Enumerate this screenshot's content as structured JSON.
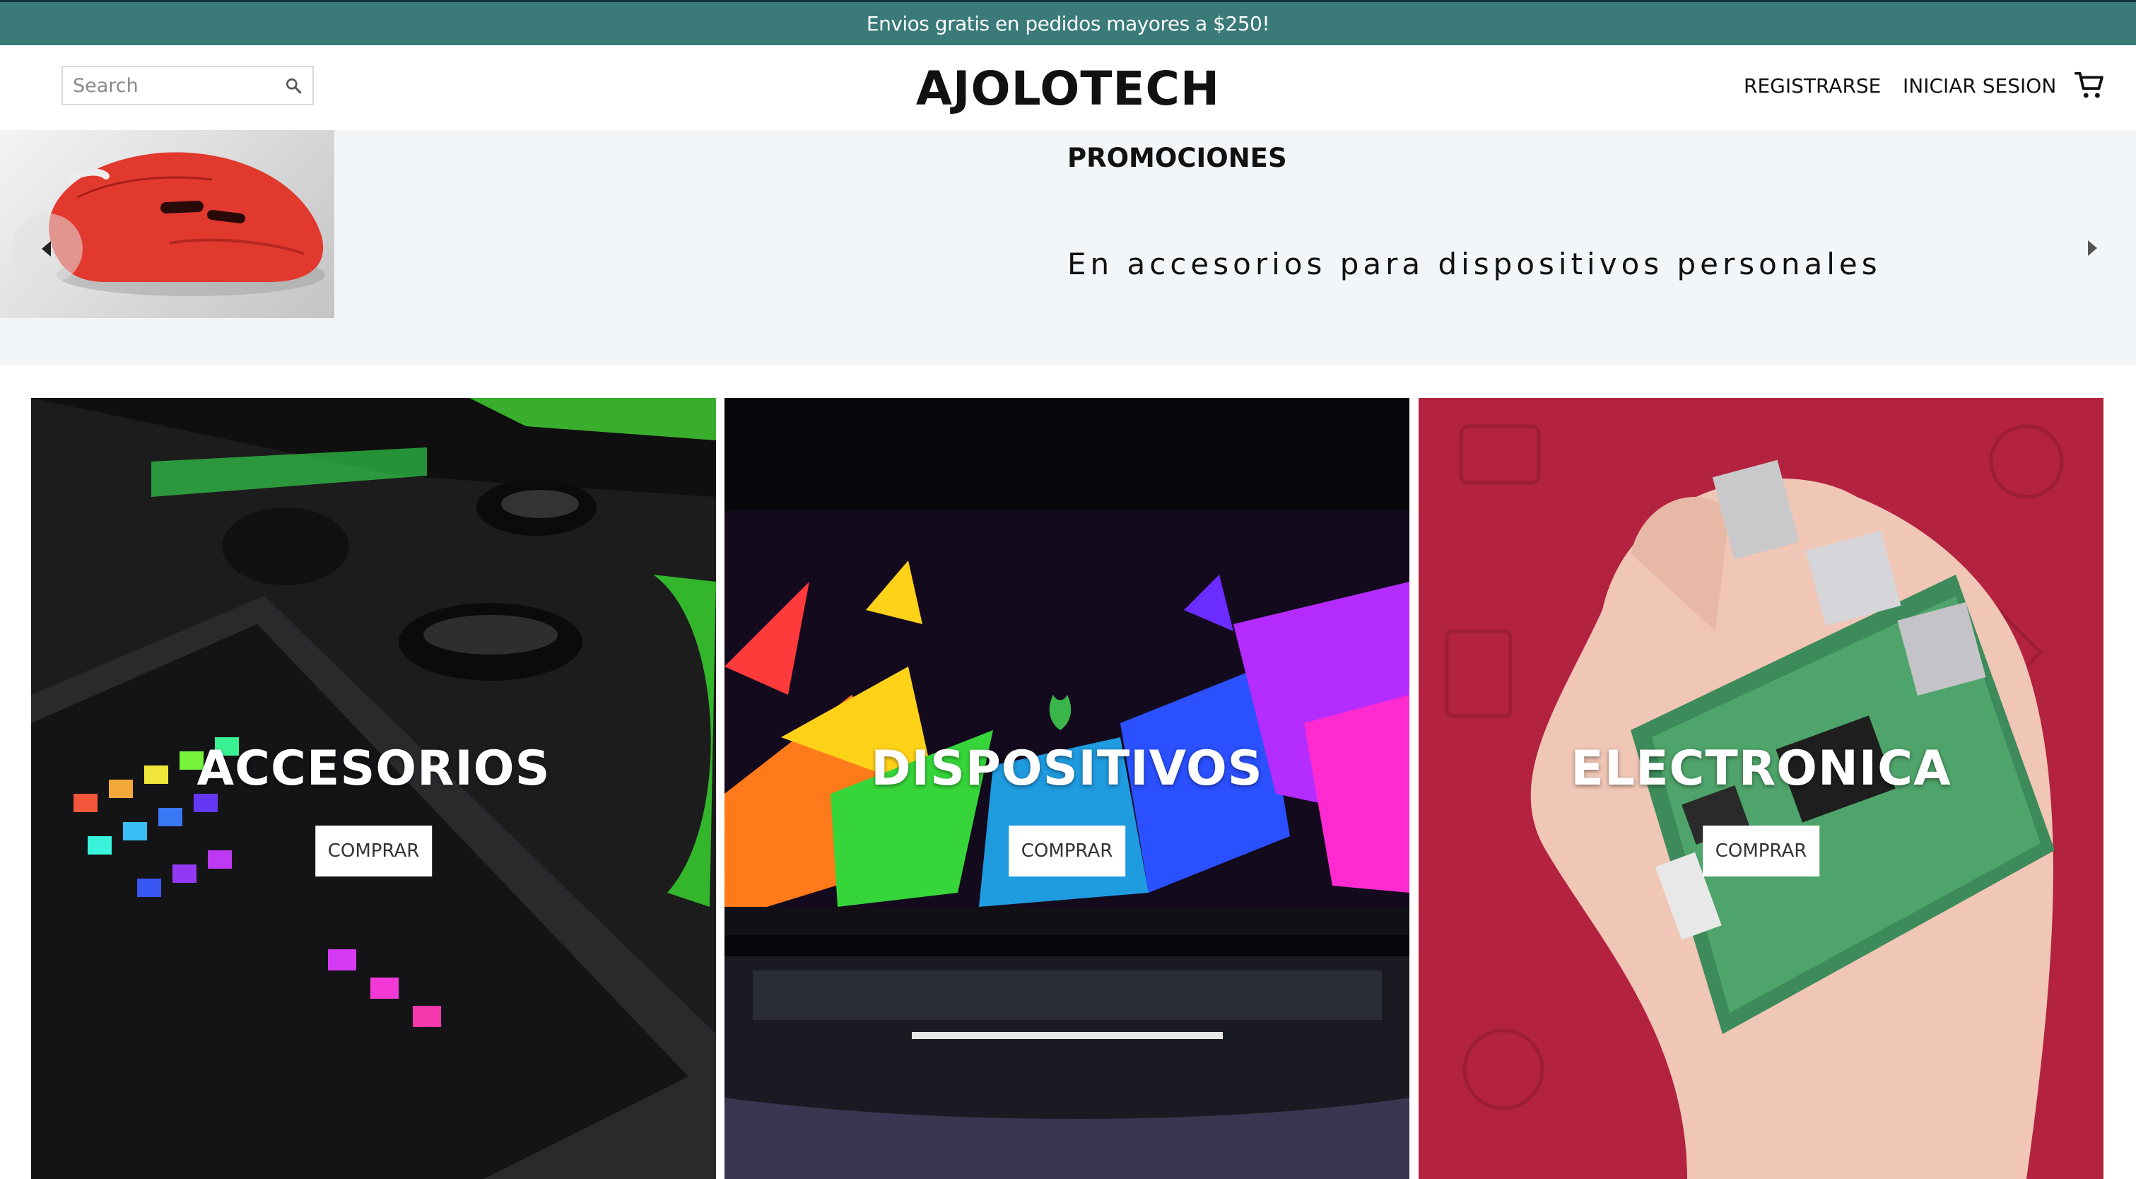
{
  "announcement": {
    "text": "Envios gratis en pedidos mayores a $250!"
  },
  "header": {
    "search_placeholder": "Search",
    "logo": "AJOLOTECH",
    "register_label": "REGISTRARSE",
    "login_label": "INICIAR SESION",
    "icons": {
      "search": "search-icon",
      "cart": "shopping-cart-icon"
    }
  },
  "promo": {
    "title": "PROMOCIONES",
    "subtitle": "En accesorios para dispositivos personales",
    "image": "red-gaming-mouse"
  },
  "categories": [
    {
      "title": "ACCESORIOS",
      "button": "COMPRAR",
      "image": "rgb-keyboard-and-car-models"
    },
    {
      "title": "DISPOSITIVOS",
      "button": "COMPRAR",
      "image": "gaming-laptop-rgb-screen"
    },
    {
      "title": "ELECTRONICA",
      "button": "COMPRAR",
      "image": "hand-holding-raspberry-pi"
    }
  ],
  "colors": {
    "announcement_bg": "#3a7a79",
    "promo_bg": "#f3f6f8",
    "electronica_bg": "#b3223e",
    "text": "#111111"
  }
}
